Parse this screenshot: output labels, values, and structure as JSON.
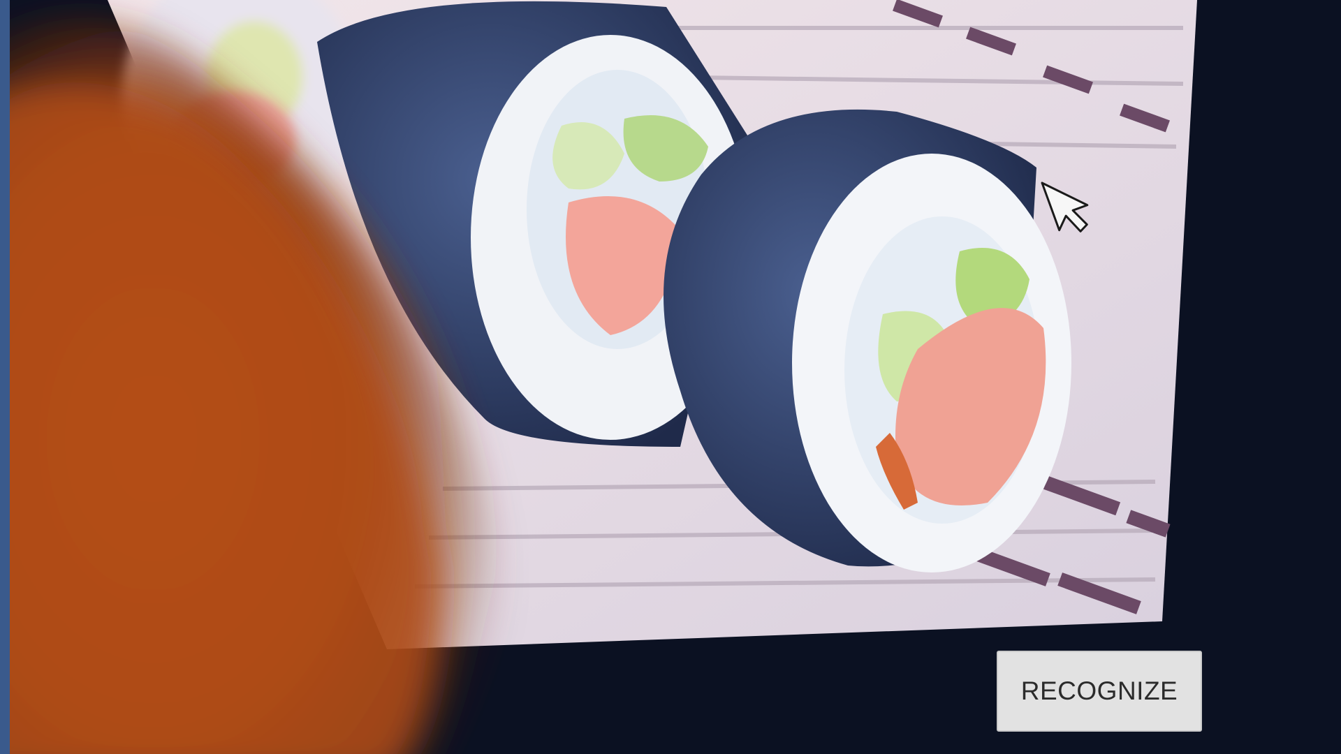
{
  "camera_view": {
    "scene": "sushi-photo-on-screen",
    "pointer_icon": "arrow-cursor-icon"
  },
  "actions": {
    "recognize_label": "RECOGNIZE"
  },
  "colors": {
    "frame": "#3a5a8c",
    "button_bg": "#e2e2e2",
    "button_text": "#2b2b2b"
  }
}
